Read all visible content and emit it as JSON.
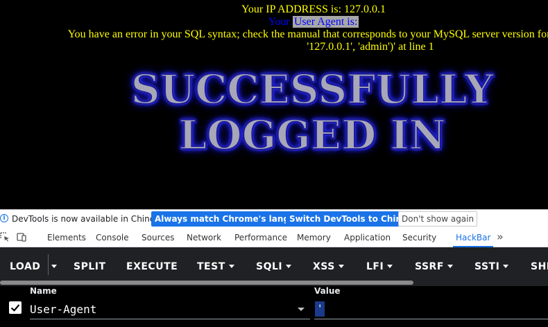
{
  "page": {
    "ip_line": "Your IP ADDRESS is: 127.0.0.1",
    "ua_prefix": "Your",
    "ua_label": "User Agent is:",
    "error_line1": "You have an error in your SQL syntax; check the manual that corresponds to your MySQL server version for the right syntax to use near",
    "error_line2": "'127.0.0.1', 'admin')' at line 1",
    "success_line1": "SUCCESSFULLY",
    "success_line2": "LOGGED IN"
  },
  "devtools": {
    "notice": {
      "text": "DevTools is now available in Chinese!",
      "always_match": "Always match Chrome's language",
      "switch": "Switch DevTools to Chinese",
      "dont_show": "Don't show again"
    },
    "tabs": [
      {
        "label": "Elements"
      },
      {
        "label": "Console"
      },
      {
        "label": "Sources"
      },
      {
        "label": "Network"
      },
      {
        "label": "Performance"
      },
      {
        "label": "Memory"
      },
      {
        "label": "Application"
      },
      {
        "label": "Security"
      },
      {
        "label": "HackBar"
      }
    ],
    "active_tab": "HackBar",
    "more_tabs": "»"
  },
  "hackbar": {
    "toolbar": {
      "load": "LOAD",
      "split": "SPLIT",
      "execute": "EXECUTE",
      "test": "TEST",
      "sqli": "SQLI",
      "xss": "XSS",
      "lfi": "LFI",
      "ssrf": "SSRF",
      "ssti": "SSTI",
      "shell": "SHE"
    },
    "fields": {
      "name_label": "Name",
      "value_label": "Value",
      "name_value": "User-Agent",
      "value_value": "'",
      "checked": true
    }
  },
  "colors": {
    "page_text": "#FFFF00",
    "ua_text": "#0000FF",
    "accent": "#1a73e8",
    "hackbar_bg": "#202124"
  }
}
